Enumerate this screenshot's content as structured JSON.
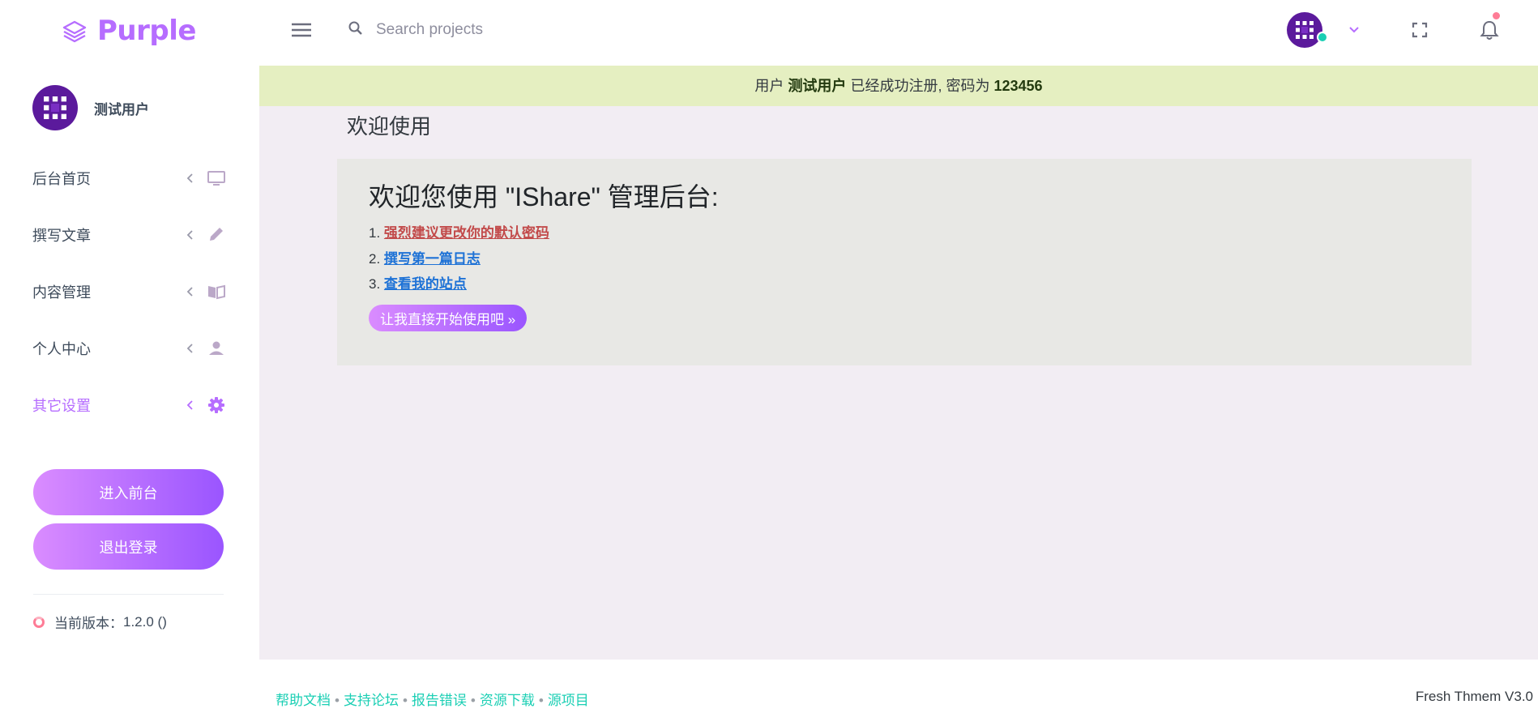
{
  "brand": {
    "name": "Purple",
    "color": "#b66dff"
  },
  "search": {
    "placeholder": "Search projects",
    "value": ""
  },
  "user": {
    "name": "测试用户"
  },
  "sidebar": {
    "items": [
      {
        "label": "后台首页",
        "icon": "monitor-icon"
      },
      {
        "label": "撰写文章",
        "icon": "pencil-icon"
      },
      {
        "label": "内容管理",
        "icon": "book-open-icon"
      },
      {
        "label": "个人中心",
        "icon": "account-icon"
      },
      {
        "label": "其它设置",
        "icon": "gear-icon",
        "active": true
      }
    ],
    "frontend_button": "进入前台",
    "logout_button": "退出登录",
    "version_label": "当前版本：",
    "version_value": "1.2.0 ()"
  },
  "alert": {
    "prefix": "用户",
    "username": "测试用户",
    "middle": "已经成功注册, 密码为",
    "password": "123456"
  },
  "main": {
    "title": "欢迎使用",
    "jumbo_title": "欢迎您使用 \"IShare\" 管理后台:",
    "steps": [
      {
        "num": "1.",
        "text": "强烈建议更改你的默认密码"
      },
      {
        "num": "2.",
        "text": "撰写第一篇日志"
      },
      {
        "num": "3.",
        "text": "查看我的站点"
      }
    ],
    "start_button": "让我直接开始使用吧 »"
  },
  "footer": {
    "links": [
      "帮助文档",
      "支持论坛",
      "报告错误",
      "资源下载",
      "源项目"
    ],
    "separator": "•",
    "credit": "Fresh Thmem V3.0"
  },
  "colors": {
    "accent": "#b66dff",
    "footer_link": "#1bcfb4",
    "alert_bg": "#e5efc1",
    "main_bg": "#f2edf3"
  }
}
